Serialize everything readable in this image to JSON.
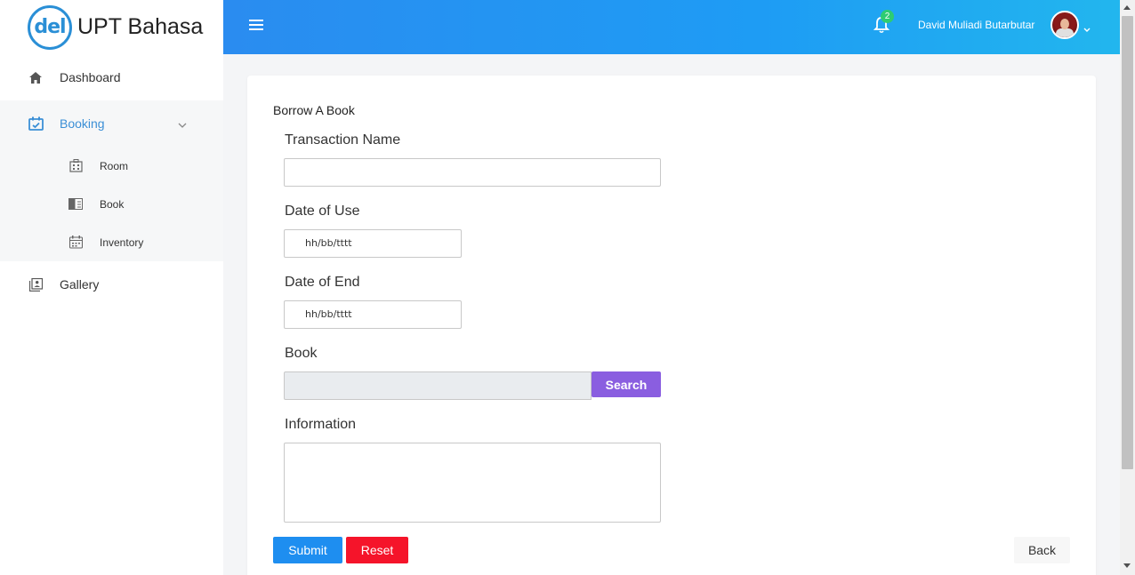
{
  "brand": {
    "logo_text": "del",
    "name": "UPT Bahasa"
  },
  "sidebar": {
    "items": [
      {
        "label": "Dashboard",
        "icon": "home-icon"
      },
      {
        "label": "Booking",
        "icon": "calendar-check-icon",
        "active": true,
        "expanded": true,
        "children": [
          {
            "label": "Room",
            "icon": "building-icon"
          },
          {
            "label": "Book",
            "icon": "book-icon"
          },
          {
            "label": "Inventory",
            "icon": "calendar-grid-icon"
          }
        ]
      },
      {
        "label": "Gallery",
        "icon": "gallery-icon"
      }
    ]
  },
  "topbar": {
    "notification_count": "2",
    "user_name": "David Muliadi Butarbutar"
  },
  "form": {
    "title": "Borrow A Book",
    "transaction_name_label": "Transaction Name",
    "transaction_name_value": "",
    "date_of_use_label": "Date of Use",
    "date_of_use_placeholder": "hh/bb/tttt",
    "date_of_end_label": "Date of End",
    "date_of_end_placeholder": "hh/bb/tttt",
    "book_label": "Book",
    "book_value": "",
    "search_label": "Search",
    "information_label": "Information",
    "information_value": "",
    "submit_label": "Submit",
    "reset_label": "Reset",
    "back_label": "Back"
  },
  "colors": {
    "topbar_start": "#2a8cf0",
    "topbar_end": "#22b6ee",
    "active_nav": "#3b8fd6",
    "search_button": "#8a5ee0",
    "submit_button": "#1e8ef0",
    "reset_button": "#f5142a",
    "badge": "#2ecc71"
  }
}
